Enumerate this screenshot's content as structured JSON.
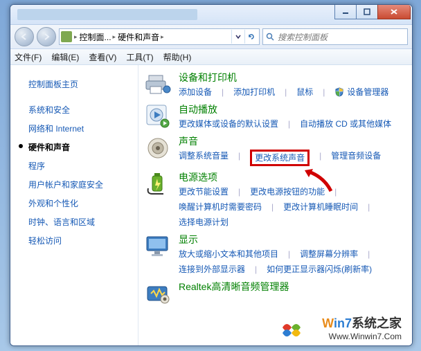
{
  "titlebar": {},
  "nav": {
    "crumb1": "控制面...",
    "crumb2": "硬件和声音",
    "sep": "▸"
  },
  "search": {
    "placeholder": "搜索控制面板"
  },
  "menu": {
    "file": "文件(F)",
    "edit": "编辑(E)",
    "view": "查看(V)",
    "tools": "工具(T)",
    "help": "帮助(H)"
  },
  "sidebar": {
    "home": "控制面板主页",
    "items": [
      "系统和安全",
      "网络和 Internet",
      "硬件和声音",
      "程序",
      "用户帐户和家庭安全",
      "外观和个性化",
      "时钟、语言和区域",
      "轻松访问"
    ],
    "active_index": 2
  },
  "categories": [
    {
      "icon": "printer",
      "title": "设备和打印机",
      "links": [
        {
          "t": "添加设备"
        },
        {
          "t": "添加打印机"
        },
        {
          "t": "鼠标"
        },
        {
          "t": "设备管理器",
          "icon": "shield"
        }
      ]
    },
    {
      "icon": "autoplay",
      "title": "自动播放",
      "links": [
        {
          "t": "更改媒体或设备的默认设置"
        },
        {
          "t": "自动播放 CD 或其他媒体"
        }
      ]
    },
    {
      "icon": "speaker",
      "title": "声音",
      "links": [
        {
          "t": "调整系统音量"
        },
        {
          "t": "更改系统声音",
          "boxed": true
        },
        {
          "t": "管理音频设备"
        }
      ]
    },
    {
      "icon": "power",
      "title": "电源选项",
      "links": [
        {
          "t": "更改节能设置"
        },
        {
          "t": "更改电源按钮的功能"
        },
        {
          "t": "唤醒计算机时需要密码"
        },
        {
          "t": "更改计算机睡眠时间"
        },
        {
          "t": "选择电源计划"
        }
      ]
    },
    {
      "icon": "display",
      "title": "显示",
      "links": [
        {
          "t": "放大或缩小文本和其他项目"
        },
        {
          "t": "调整屏幕分辨率"
        },
        {
          "t": "连接到外部显示器"
        },
        {
          "t": "如何更正显示器闪烁(刷新率)"
        }
      ]
    },
    {
      "icon": "realtek",
      "title": "Realtek高清晰音频管理器",
      "links": []
    }
  ],
  "watermark": {
    "w": "W",
    "in7": "in7",
    "rest": "系统之家",
    "url": "Www.Winwin7.Com"
  }
}
